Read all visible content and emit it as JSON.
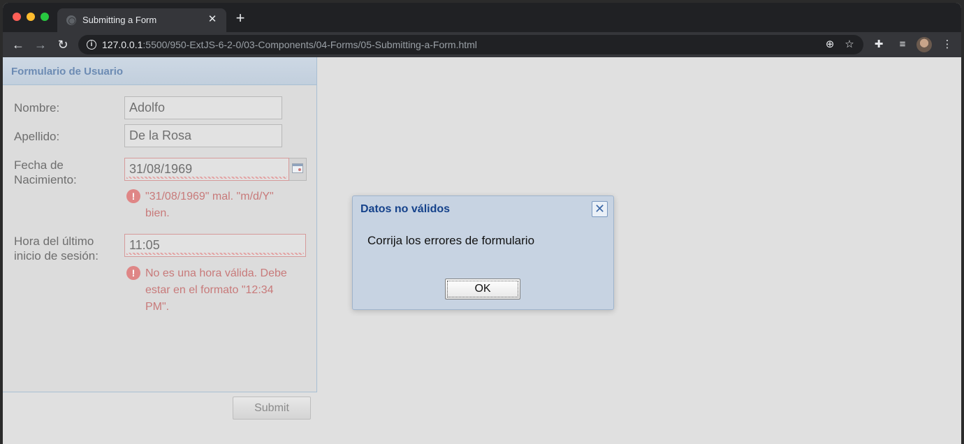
{
  "browser": {
    "tab_title": "Submitting a Form",
    "url_host": "127.0.0.1",
    "url_path": ":5500/950-ExtJS-6-2-0/03-Components/04-Forms/05-Submitting-a-Form.html"
  },
  "form": {
    "title": "Formulario de Usuario",
    "fields": [
      {
        "label": "Nombre:",
        "value": "Adolfo"
      },
      {
        "label": "Apellido:",
        "value": "De la Rosa"
      },
      {
        "label_line1": "Fecha de",
        "label_line2": "Nacimiento:",
        "value": "31/08/1969",
        "error": "\"31/08/1969\" mal. \"m/d/Y\" bien."
      },
      {
        "label_line1": "Hora del último",
        "label_line2": "inicio de sesión:",
        "value": "11:05",
        "error": "No es una hora válida. Debe estar en el formato \"12:34 PM\"."
      }
    ],
    "submit_label": "Submit"
  },
  "dialog": {
    "title": "Datos no válidos",
    "message": "Corrija los errores de formulario",
    "ok_label": "OK"
  },
  "colors": {
    "panel_title": "#6c8bb3",
    "dialog_title": "#15428b",
    "error_text": "#c87a7a"
  }
}
